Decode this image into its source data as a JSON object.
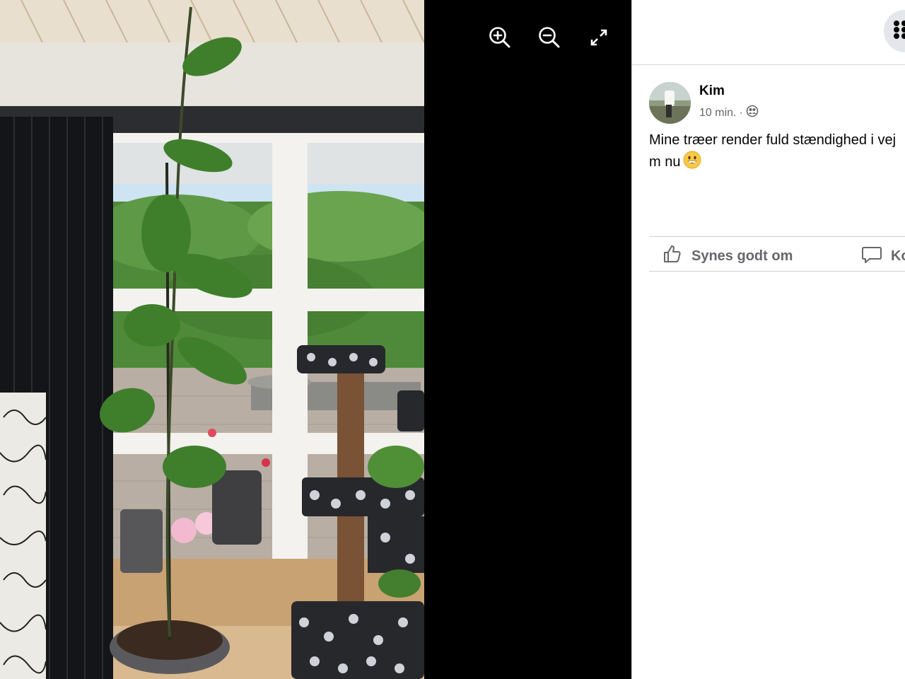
{
  "viewer": {
    "zoom_in_icon": "zoom-in-icon",
    "zoom_out_icon": "zoom-out-icon",
    "fullscreen_icon": "expand-icon",
    "background": "#000000"
  },
  "post": {
    "author_name": "Kim",
    "time": "10 min.",
    "separator": "·",
    "audience_icon": "friends-icon",
    "text_line1": "Mine træer render fuld stændighed i vej",
    "text_line2": "m nu",
    "emoji_icon": "grinning-face-emoji"
  },
  "actions": {
    "like_label": "Synes godt om",
    "comment_label": "Ko",
    "like_icon": "thumbs-up-icon",
    "comment_icon": "comment-bubble-icon"
  },
  "header": {
    "menu_icon": "grid-menu-icon"
  },
  "colors": {
    "text_primary": "#050505",
    "text_secondary": "#65676b",
    "divider": "#ced0d4",
    "button_bg": "#e4e6eb"
  }
}
